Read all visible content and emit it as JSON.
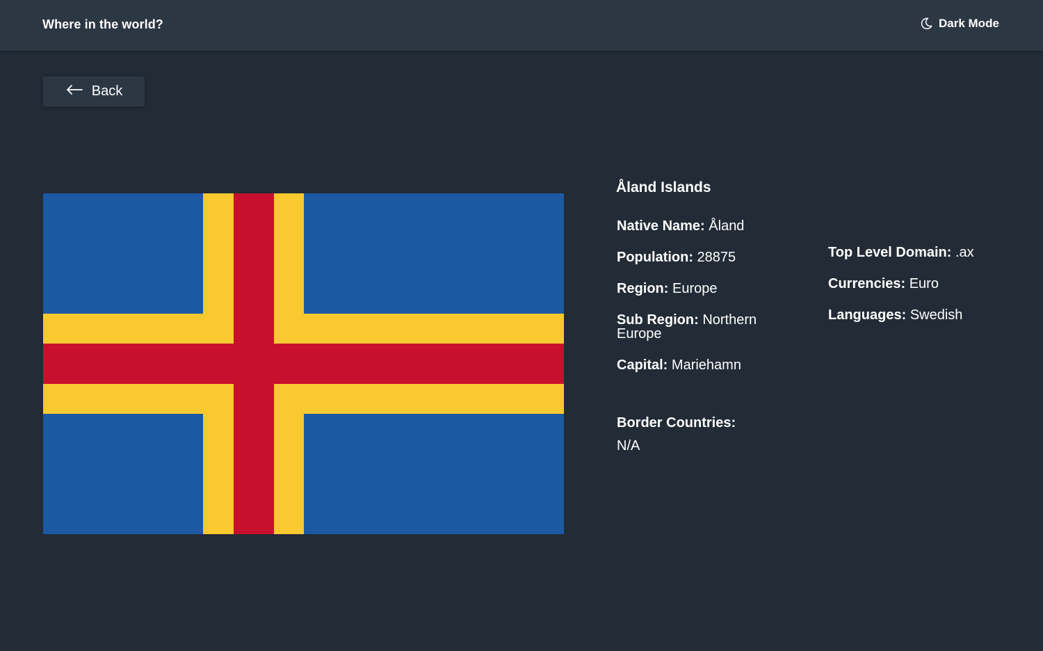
{
  "header": {
    "title": "Where in the world?",
    "mode_label": "Dark Mode",
    "mode_icon": "moon-icon"
  },
  "back": {
    "label": "Back",
    "icon": "arrow-left-icon"
  },
  "country": {
    "name": "Åland Islands",
    "flag": {
      "description_icon": "flag-image",
      "colors": {
        "field": "#1b59a3",
        "outer_cross": "#f9c92f",
        "inner_cross": "#c8102e"
      }
    },
    "details_left": [
      {
        "label": "Native Name:",
        "value": "Åland"
      },
      {
        "label": "Population:",
        "value": "28875"
      },
      {
        "label": "Region:",
        "value": "Europe"
      },
      {
        "label": "Sub Region:",
        "value": "Northern Europe"
      },
      {
        "label": "Capital:",
        "value": "Mariehamn"
      }
    ],
    "details_right": [
      {
        "label": "Top Level Domain:",
        "value": ".ax"
      },
      {
        "label": "Currencies:",
        "value": "Euro"
      },
      {
        "label": "Languages:",
        "value": "Swedish"
      }
    ],
    "border": {
      "title": "Border Countries:",
      "value": "N/A"
    }
  },
  "colors": {
    "background": "#222b36",
    "element": "#2c3744",
    "text": "#ffffff"
  }
}
